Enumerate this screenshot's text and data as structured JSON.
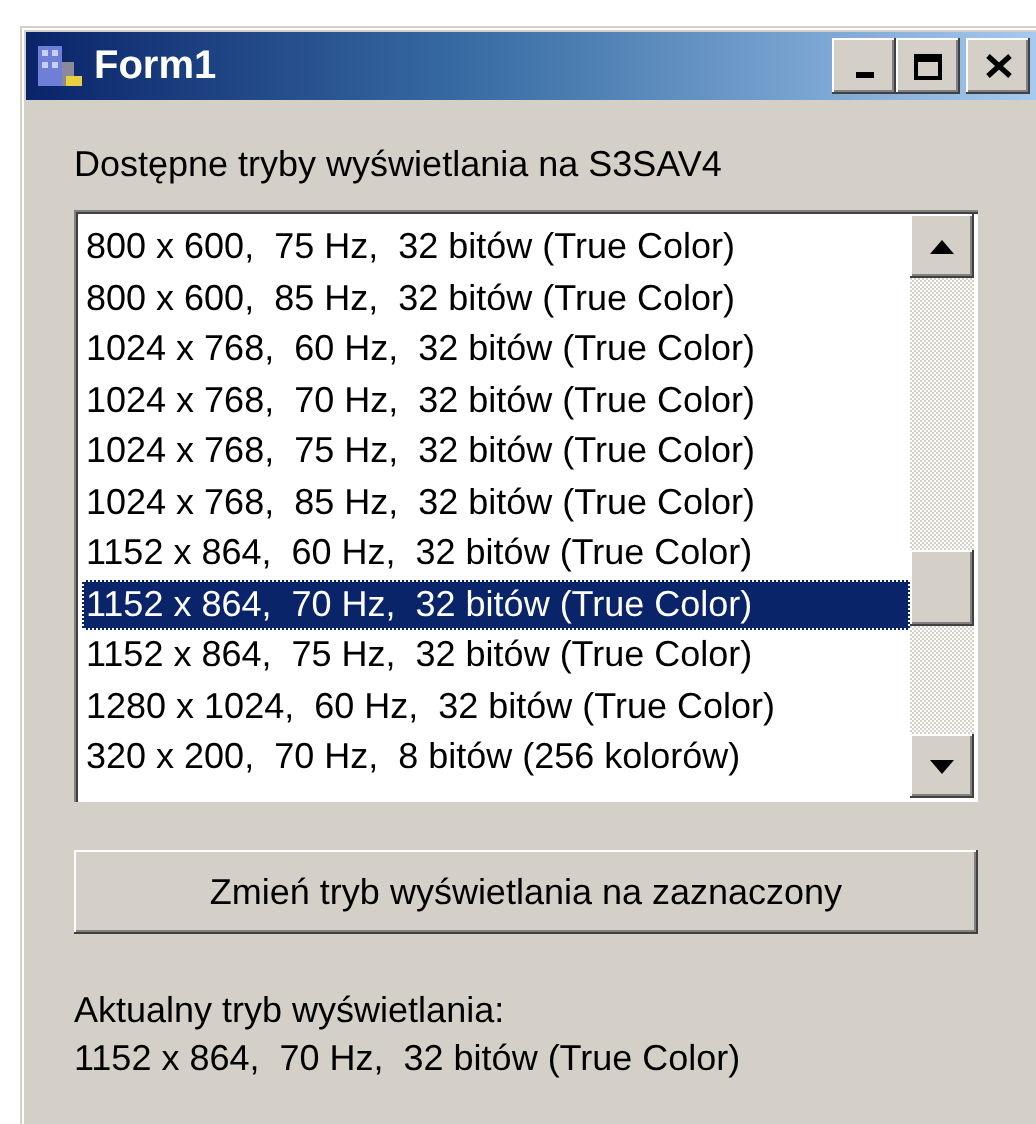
{
  "window": {
    "title": "Form1"
  },
  "list_label": "Dostępne tryby wyświetlania na S3SAV4",
  "modes": [
    {
      "label": "800 x 600,  75 Hz,  32 bitów (True Color)",
      "selected": false
    },
    {
      "label": "800 x 600,  85 Hz,  32 bitów (True Color)",
      "selected": false
    },
    {
      "label": "1024 x 768,  60 Hz,  32 bitów (True Color)",
      "selected": false
    },
    {
      "label": "1024 x 768,  70 Hz,  32 bitów (True Color)",
      "selected": false
    },
    {
      "label": "1024 x 768,  75 Hz,  32 bitów (True Color)",
      "selected": false
    },
    {
      "label": "1024 x 768,  85 Hz,  32 bitów (True Color)",
      "selected": false
    },
    {
      "label": "1152 x 864,  60 Hz,  32 bitów (True Color)",
      "selected": false
    },
    {
      "label": "1152 x 864,  70 Hz,  32 bitów (True Color)",
      "selected": true
    },
    {
      "label": "1152 x 864,  75 Hz,  32 bitów (True Color)",
      "selected": false
    },
    {
      "label": "1280 x 1024,  60 Hz,  32 bitów (True Color)",
      "selected": false
    },
    {
      "label": "320 x 200,  70 Hz,  8 bitów (256 kolorów)",
      "selected": false
    }
  ],
  "apply_button": "Zmień tryb wyświetlania na zaznaczony",
  "current_label": "Aktualny tryb wyświetlania:",
  "current_value": "1152 x 864,  70 Hz,  32 bitów (True Color)"
}
